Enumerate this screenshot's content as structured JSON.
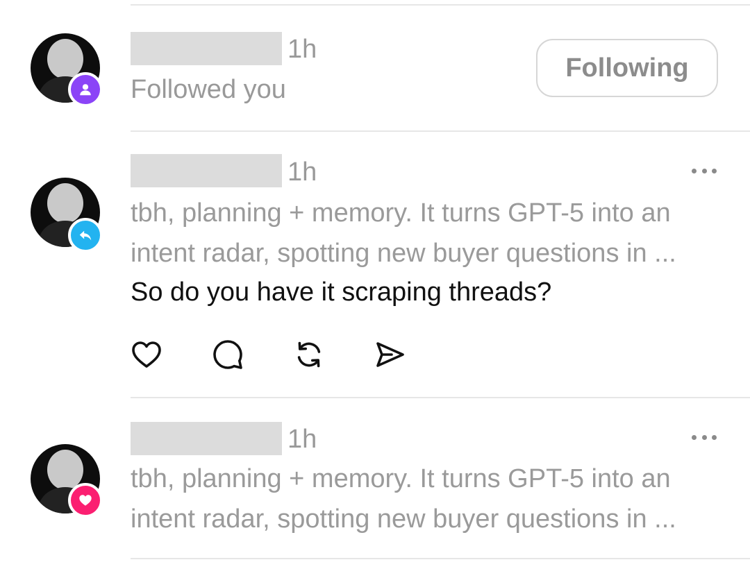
{
  "notifications": [
    {
      "type": "follow",
      "time": "1h",
      "subtext": "Followed you",
      "button_label": "Following",
      "badge_color": "#8b44f7",
      "badge_icon": "person-icon"
    },
    {
      "type": "reply",
      "time": "1h",
      "preview_lines": [
        "tbh, planning + memory. It turns GPT-5 into an",
        "intent radar, spotting new buyer questions in ..."
      ],
      "reply_text": "So do you have it scraping threads?",
      "badge_color": "#23b3f0",
      "badge_icon": "reply-arrow-icon",
      "actions": [
        "heart-icon",
        "comment-icon",
        "repost-icon",
        "share-icon"
      ]
    },
    {
      "type": "like",
      "time": "1h",
      "preview_lines": [
        "tbh, planning + memory. It turns GPT-5 into an",
        "intent radar, spotting new buyer questions in ..."
      ],
      "badge_color": "#fb1f71",
      "badge_icon": "heart-icon"
    }
  ]
}
